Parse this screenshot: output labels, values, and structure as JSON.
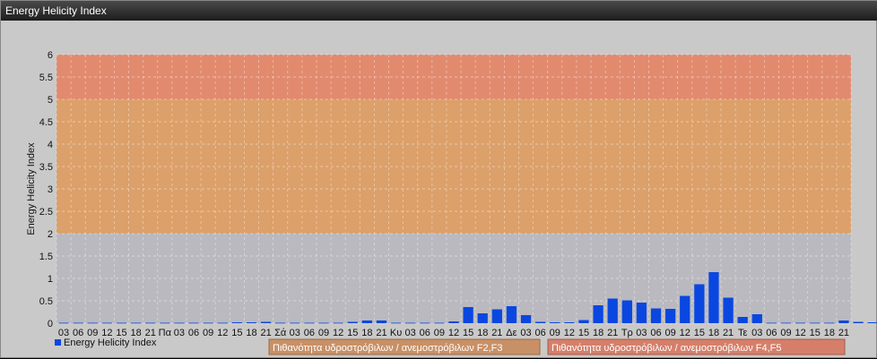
{
  "window": {
    "title": "Energy Helicity Index"
  },
  "chart_data": {
    "type": "bar",
    "ylabel": "Energy Helicity Index",
    "ylim": [
      0,
      6
    ],
    "yticks": [
      "0",
      "0.5",
      "1",
      "1.5",
      "2",
      "2.5",
      "3",
      "3.5",
      "4",
      "4.5",
      "5",
      "5.5",
      "6"
    ],
    "grid": true,
    "categories": [
      "03",
      "06",
      "09",
      "12",
      "15",
      "18",
      "21",
      "Πα",
      "03",
      "06",
      "09",
      "12",
      "15",
      "18",
      "21",
      "Σά",
      "03",
      "06",
      "09",
      "12",
      "15",
      "18",
      "21",
      "Κυ",
      "03",
      "06",
      "09",
      "12",
      "15",
      "18",
      "21",
      "Δε",
      "03",
      "06",
      "09",
      "12",
      "15",
      "18",
      "21",
      "Τρ",
      "03",
      "06",
      "09",
      "12",
      "15",
      "18",
      "21",
      "Τε",
      "03",
      "06",
      "09",
      "12",
      "15",
      "18",
      "21"
    ],
    "series": [
      {
        "name": "Energy Helicity Index",
        "color": "#0a47e0",
        "values": [
          0.01,
          0.01,
          0.01,
          0.01,
          0.01,
          0.01,
          0.01,
          0.01,
          0.01,
          0.01,
          0.01,
          0.01,
          0.02,
          0.02,
          0.03,
          0.01,
          0.01,
          0.01,
          0.01,
          0.01,
          0.03,
          0.06,
          0.06,
          0.01,
          0.01,
          0.01,
          0.01,
          0.04,
          0.36,
          0.22,
          0.31,
          0.38,
          0.18,
          0.03,
          0.02,
          0.02,
          0.07,
          0.4,
          0.55,
          0.51,
          0.46,
          0.33,
          0.32,
          0.61,
          0.87,
          1.14,
          0.57,
          0.14,
          0.2,
          0.01,
          0.01,
          0.01,
          0.01,
          0.01,
          0.06,
          0.03,
          0.02
        ]
      }
    ],
    "bands": [
      {
        "from": 0,
        "to": 2,
        "color": "#b9b9bf"
      },
      {
        "from": 2,
        "to": 5,
        "color": "#dca06a"
      },
      {
        "from": 5,
        "to": 6,
        "color": "#e28a6e"
      }
    ],
    "legend": "bottom-left"
  },
  "band_legend": [
    {
      "label": "Πιθανότητα υδροστρόβιλων / ανεμοστρόβιλων F2,F3",
      "color": "#c89066",
      "border": "#9c6a45"
    },
    {
      "label": "Πιθανότητα υδροστρόβιλων / ανεμοστρόβιλων F4,F5",
      "color": "#d57f6a",
      "border": "#a85a48"
    }
  ]
}
